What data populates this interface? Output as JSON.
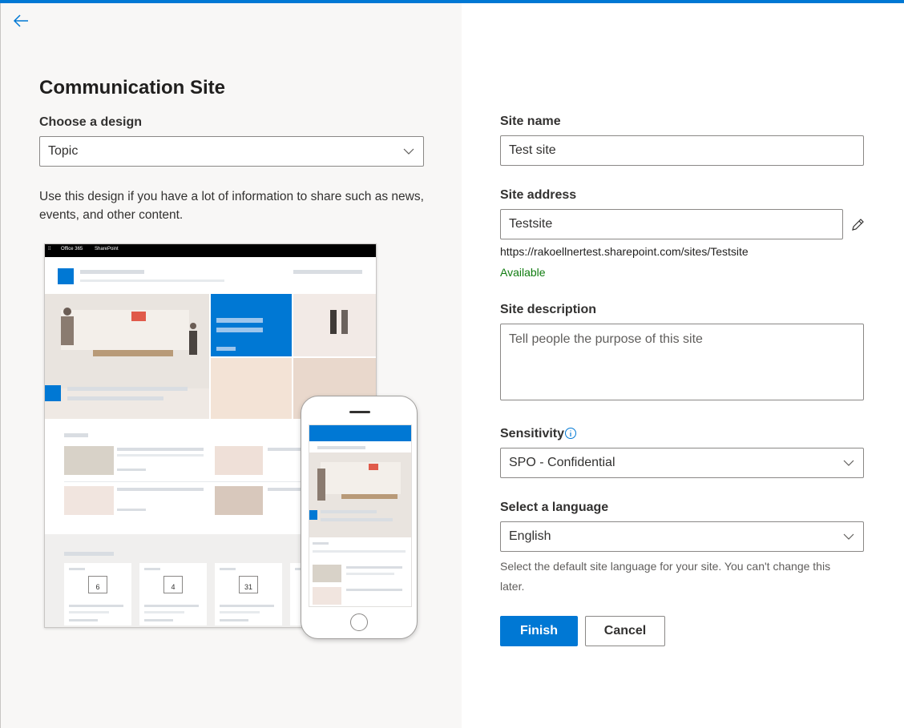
{
  "header": {
    "back_icon": "arrow-left-icon",
    "accent": "#0078d4"
  },
  "left": {
    "title": "Communication Site",
    "design_label": "Choose a design",
    "design_value": "Topic",
    "design_description": "Use this design if you have a lot of information to share such as news, events, and other content.",
    "preview": {
      "bar_office": "Office 365",
      "bar_sharepoint": "SharePoint",
      "dates": [
        "6",
        "4",
        "31"
      ]
    }
  },
  "form": {
    "site_name_label": "Site name",
    "site_name_value": "Test site",
    "site_address_label": "Site address",
    "site_address_value": "Testsite",
    "site_url": "https://rakoellnertest.sharepoint.com/sites/Testsite",
    "availability": "Available",
    "availability_color": "#107c10",
    "description_label": "Site description",
    "description_placeholder": "Tell people the purpose of this site",
    "sensitivity_label": "Sensitivity",
    "sensitivity_value": "SPO - Confidential",
    "language_label": "Select a language",
    "language_value": "English",
    "language_hint": "Select the default site language for your site. You can't change this later.",
    "finish_label": "Finish",
    "cancel_label": "Cancel"
  }
}
